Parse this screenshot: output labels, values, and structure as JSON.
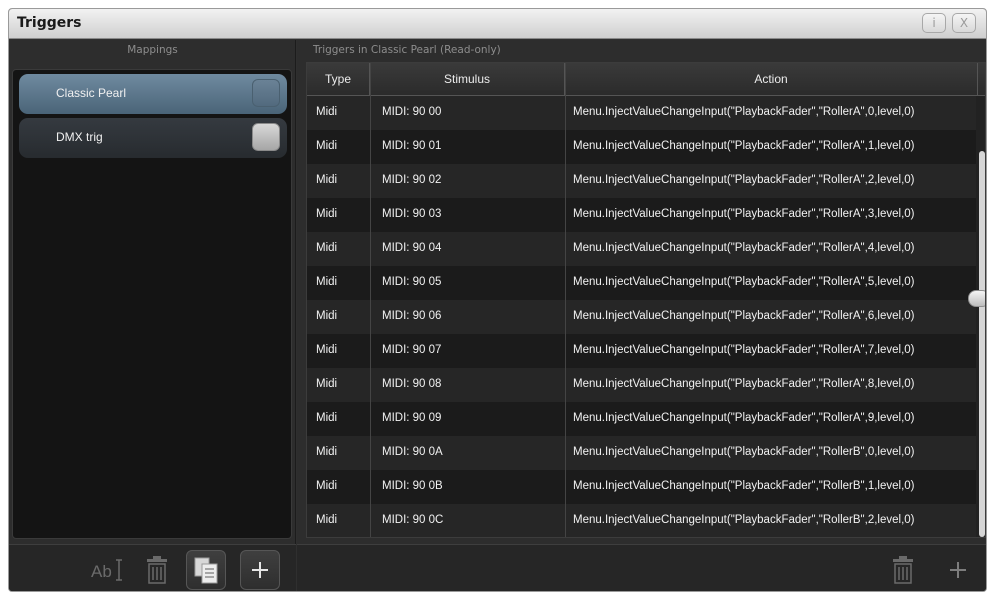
{
  "window": {
    "title": "Triggers",
    "info_label": "i",
    "close_label": "X"
  },
  "mappings": {
    "header": "Mappings",
    "items": [
      {
        "label": "Classic Pearl",
        "selected": true
      },
      {
        "label": "DMX trig",
        "selected": false
      }
    ],
    "toolbar": [
      "rename-icon",
      "trash-icon",
      "copy-icon",
      "plus-icon"
    ]
  },
  "triggers": {
    "header": "Triggers in Classic Pearl (Read-only)",
    "columns": [
      "Type",
      "Stimulus",
      "Action"
    ],
    "rows": [
      [
        "Midi",
        "MIDI: 90 00",
        "Menu.InjectValueChangeInput(\"PlaybackFader\",\"RollerA\",0,level,0)"
      ],
      [
        "Midi",
        "MIDI: 90 01",
        "Menu.InjectValueChangeInput(\"PlaybackFader\",\"RollerA\",1,level,0)"
      ],
      [
        "Midi",
        "MIDI: 90 02",
        "Menu.InjectValueChangeInput(\"PlaybackFader\",\"RollerA\",2,level,0)"
      ],
      [
        "Midi",
        "MIDI: 90 03",
        "Menu.InjectValueChangeInput(\"PlaybackFader\",\"RollerA\",3,level,0)"
      ],
      [
        "Midi",
        "MIDI: 90 04",
        "Menu.InjectValueChangeInput(\"PlaybackFader\",\"RollerA\",4,level,0)"
      ],
      [
        "Midi",
        "MIDI: 90 05",
        "Menu.InjectValueChangeInput(\"PlaybackFader\",\"RollerA\",5,level,0)"
      ],
      [
        "Midi",
        "MIDI: 90 06",
        "Menu.InjectValueChangeInput(\"PlaybackFader\",\"RollerA\",6,level,0)"
      ],
      [
        "Midi",
        "MIDI: 90 07",
        "Menu.InjectValueChangeInput(\"PlaybackFader\",\"RollerA\",7,level,0)"
      ],
      [
        "Midi",
        "MIDI: 90 08",
        "Menu.InjectValueChangeInput(\"PlaybackFader\",\"RollerA\",8,level,0)"
      ],
      [
        "Midi",
        "MIDI: 90 09",
        "Menu.InjectValueChangeInput(\"PlaybackFader\",\"RollerA\",9,level,0)"
      ],
      [
        "Midi",
        "MIDI: 90 0A",
        "Menu.InjectValueChangeInput(\"PlaybackFader\",\"RollerB\",0,level,0)"
      ],
      [
        "Midi",
        "MIDI: 90 0B",
        "Menu.InjectValueChangeInput(\"PlaybackFader\",\"RollerB\",1,level,0)"
      ],
      [
        "Midi",
        "MIDI: 90 0C",
        "Menu.InjectValueChangeInput(\"PlaybackFader\",\"RollerB\",2,level,0)"
      ]
    ],
    "toolbar": [
      "trash-icon",
      "plus-icon"
    ]
  }
}
